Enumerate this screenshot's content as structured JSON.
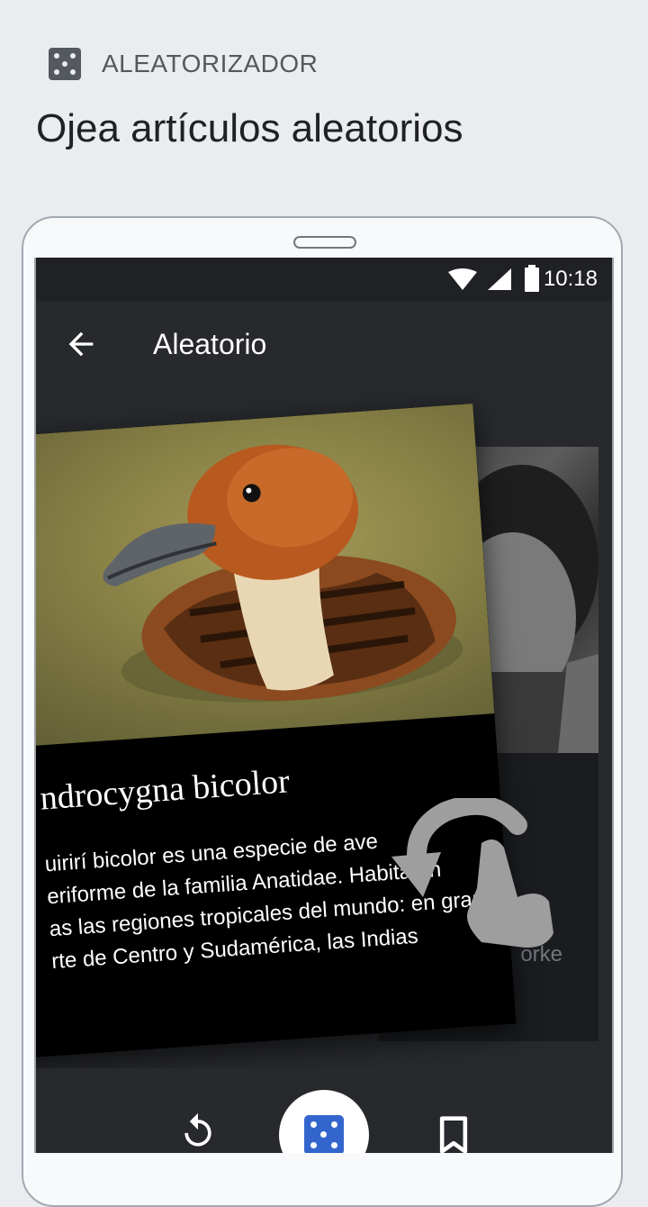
{
  "onboarding": {
    "section_label": "ALEATORIZADOR",
    "headline": "Ojea artículos aleatorios"
  },
  "status_bar": {
    "time": "10:18",
    "icons": [
      "wifi-icon",
      "signal-icon",
      "battery-icon"
    ]
  },
  "toolbar": {
    "back_icon": "arrow-left-icon",
    "title": "Aleatorio"
  },
  "front_card": {
    "title": "ndrocygna bicolor",
    "body_lines": [
      "uirirí bicolor es una especie de ave",
      "eriforme de la familia Anatidae. Habita en",
      "as las regiones tropicales del mundo: en gran",
      "rte de Centro y Sudamérica, las Indias"
    ]
  },
  "back_card": {
    "text": "orke"
  },
  "bottom_bar": {
    "actions": [
      "refresh-icon",
      "dice-icon",
      "bookmark-icon"
    ]
  },
  "colors": {
    "page_background": "#eaecf0",
    "screen_background": "#27292d",
    "accent": "#36c"
  }
}
